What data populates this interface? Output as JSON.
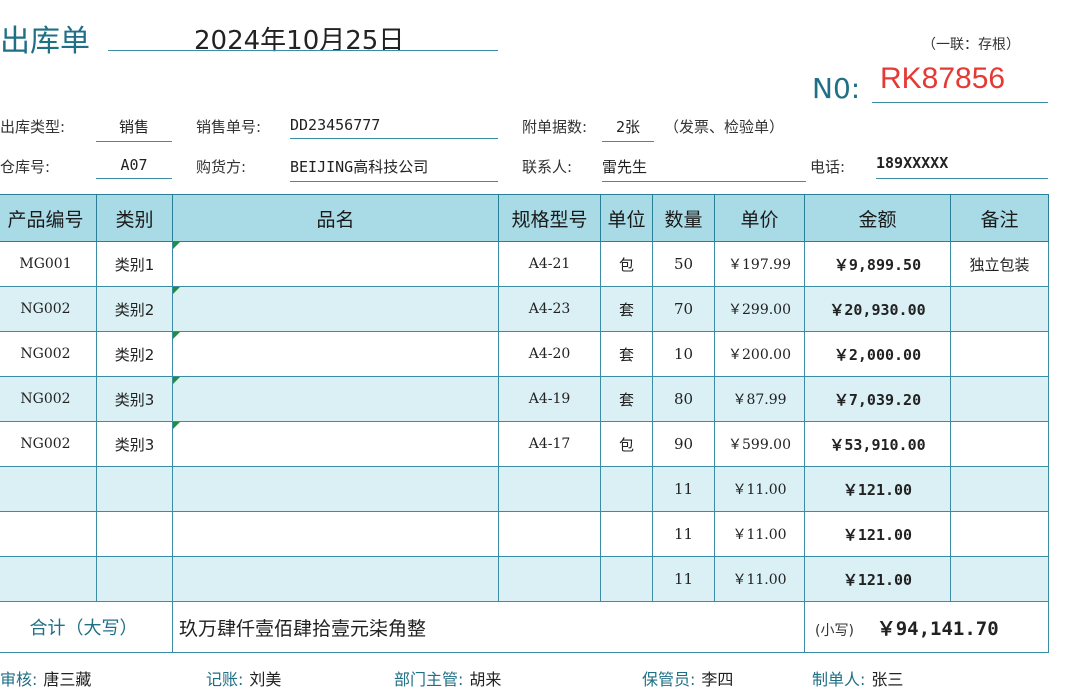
{
  "header": {
    "title": "出库单",
    "date": "2024年10月25日",
    "copy_note": "（一联：存根）",
    "no_label": "N0:",
    "no_value": "RK87856"
  },
  "info": {
    "type_label": "出库类型:",
    "type_value": "销售",
    "order_label": "销售单号:",
    "order_value": "DD23456777",
    "attach_label": "附单据数:",
    "attach_value": "2张",
    "attach_note": "（发票、检验单）",
    "warehouse_label": "仓库号:",
    "warehouse_value": "A07",
    "buyer_label": "购货方:",
    "buyer_value": "BEIJING高科技公司",
    "contact_label": "联系人:",
    "contact_value": "雷先生",
    "phone_label": "电话:",
    "phone_value": "189XXXXX"
  },
  "table": {
    "headers": [
      "产品编号",
      "类别",
      "品名",
      "规格型号",
      "单位",
      "数量",
      "单价",
      "金额",
      "备注"
    ],
    "rows": [
      {
        "code": "MG001",
        "cat": "类别1",
        "name": "",
        "spec": "A4-21",
        "unit": "包",
        "qty": "50",
        "price": "￥197.99",
        "amount": "￥9,899.50",
        "note": "独立包装"
      },
      {
        "code": "NG002",
        "cat": "类别2",
        "name": "",
        "spec": "A4-23",
        "unit": "套",
        "qty": "70",
        "price": "￥299.00",
        "amount": "￥20,930.00",
        "note": ""
      },
      {
        "code": "NG002",
        "cat": "类别2",
        "name": "",
        "spec": "A4-20",
        "unit": "套",
        "qty": "10",
        "price": "￥200.00",
        "amount": "￥2,000.00",
        "note": ""
      },
      {
        "code": "NG002",
        "cat": "类别3",
        "name": "",
        "spec": "A4-19",
        "unit": "套",
        "qty": "80",
        "price": "￥87.99",
        "amount": "￥7,039.20",
        "note": ""
      },
      {
        "code": "NG002",
        "cat": "类别3",
        "name": "",
        "spec": "A4-17",
        "unit": "包",
        "qty": "90",
        "price": "￥599.00",
        "amount": "￥53,910.00",
        "note": ""
      },
      {
        "code": "",
        "cat": "",
        "name": "",
        "spec": "",
        "unit": "",
        "qty": "11",
        "price": "￥11.00",
        "amount": "￥121.00",
        "note": ""
      },
      {
        "code": "",
        "cat": "",
        "name": "",
        "spec": "",
        "unit": "",
        "qty": "11",
        "price": "￥11.00",
        "amount": "￥121.00",
        "note": ""
      },
      {
        "code": "",
        "cat": "",
        "name": "",
        "spec": "",
        "unit": "",
        "qty": "11",
        "price": "￥11.00",
        "amount": "￥121.00",
        "note": ""
      }
    ],
    "total_label": "合计（大写）",
    "total_chinese": "玖万肆仟壹佰肆拾壹元柒角整",
    "small_label": "(小写)",
    "total_number": "￥94,141.70"
  },
  "footer": {
    "audit_label": "审核:",
    "audit_value": "唐三藏",
    "account_label": "记账:",
    "account_value": "刘美",
    "dept_label": "部门主管:",
    "dept_value": "胡来",
    "keeper_label": "保管员:",
    "keeper_value": "李四",
    "maker_label": "制单人:",
    "maker_value": "张三"
  }
}
